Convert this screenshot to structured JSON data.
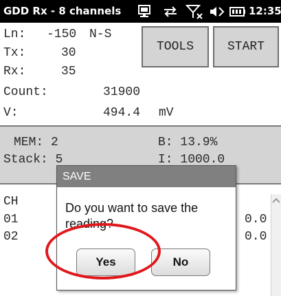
{
  "status_bar": {
    "title": "GDD Rx - 8 channels",
    "time": "12:35",
    "icons": [
      "sync-icon",
      "network-icon",
      "signal-icon",
      "volume-icon",
      "battery-icon"
    ]
  },
  "readout": {
    "ln_label": "Ln:",
    "ln_value": "-150",
    "ln_dir": "N-S",
    "tx_label": "Tx:",
    "tx_value": "30",
    "rx_label": "Rx:",
    "rx_value": "35",
    "count_label": "Count:",
    "count_value": "31900",
    "v_label": "V:",
    "v_value": "494.4",
    "v_unit": "mV"
  },
  "toolbar": {
    "tools_label": "TOOLS",
    "start_label": "START"
  },
  "memory": {
    "mem_text": "MEM: 2",
    "b_text": "B: 13.9%",
    "stack_text": "Stack: 5",
    "i_text": "I: 1000.0"
  },
  "channels": {
    "header": "CH",
    "rows": [
      {
        "ch": "01",
        "value": "0.0"
      },
      {
        "ch": "02",
        "value": "0.0"
      }
    ]
  },
  "dialog": {
    "title": "SAVE",
    "message": "Do you want to save the reading?",
    "yes_label": "Yes",
    "no_label": "No"
  },
  "colors": {
    "status_bar": "#000000",
    "panel_gray": "#d4d4d4",
    "dialog_title": "#808080",
    "highlight": "#e0181c"
  }
}
